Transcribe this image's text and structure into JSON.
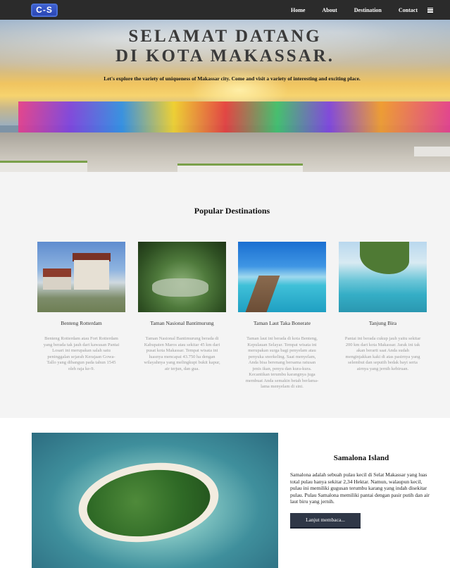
{
  "nav": {
    "logo": "C-S",
    "links": [
      "Home",
      "About",
      "Destination",
      "Contact"
    ],
    "menu_icon": "hamburger-menu-icon"
  },
  "hero": {
    "title_line1": "SELAMAT DATANG",
    "title_line2": "DI KOTA MAKASSAR.",
    "subtitle": "Let's explore the variety of uniqueness of Makassar city. Come and visit a variety of interesting and exciting place.",
    "sign_text": "CITY OF MAKASSAR"
  },
  "popular": {
    "title": "Popular Destinations",
    "cards": [
      {
        "title": "Benteng Rotterdam",
        "desc": "Benteng Rotterdam atau Fort Rotterdam yang berada tak jauh dari kawasan Pantai Losari ini merupakan salah satu peninggalan sejarah Kerajaan Gowa-Tallo yang dibangun pada tahun 1545 oleh raja ke-9."
      },
      {
        "title": "Taman Nasional Bantimurung",
        "desc": "Taman Nasional Bantimurung berada di Kabupaten Maros atau sekitar 45 km dari pusat kota Makassar. Tempat wisata ini luasnya mencapai 43.750 ha dengan wilayahnya yang melingkupi bukit kapur, air terjun, dan gua."
      },
      {
        "title": "Taman Laut Taka Bonerate",
        "desc": "Taman laut ini berada di kota Benteng, Kepulauan Selayar. Tempat wisata ini merupakan surga bagi penyelam atau penyuka snorkeling. Saat menyelam, Anda bisa berenang bersama ratusan jenis ikan, penyu dan kura-kura. Kecantikan terumbu karangnya juga membuat Anda semakin betah berlama-lama menyelam di sini."
      },
      {
        "title": "Tanjung Bira",
        "desc": "Pantai ini berada cukup jauh yaitu sekitar 200 km dari kota Makassar. Jarak ini tak akan berarti saat Anda sudah menginjakkan kaki di atas pasirnya yang selembut dan seputih bedak bayi serta airnya yang jernih kebiruan."
      }
    ]
  },
  "samalona": {
    "title": "Samalona Island",
    "desc": "Samalona adalah sebuah pulau kecil di Selat Makassar yang luas total pulau hanya sekitar 2,34 Hektar. Namun, walaupun kecil, pulau ini memiliki gugusan terumbu karang yang indah disekitar pulau. Pulau Samalona memiliki pantai dengan pasir putih dan air laut biru yang jernih.",
    "button": "Lanjut membaca..."
  }
}
